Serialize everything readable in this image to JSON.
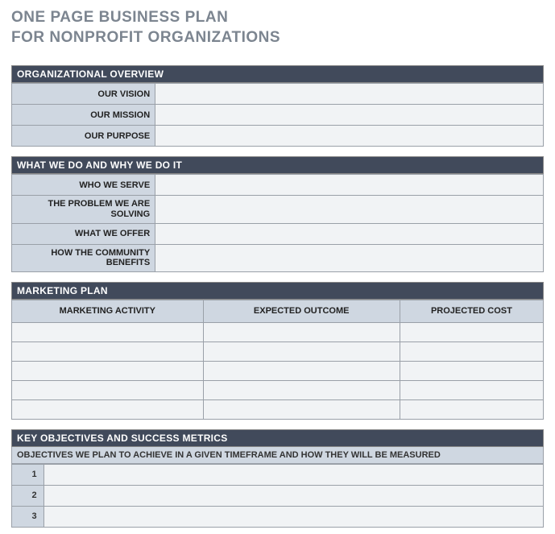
{
  "title_line1": "ONE PAGE BUSINESS PLAN",
  "title_line2": "FOR NONPROFIT ORGANIZATIONS",
  "sections": {
    "overview": {
      "header": "ORGANIZATIONAL OVERVIEW",
      "rows": [
        {
          "label": "OUR VISION",
          "value": ""
        },
        {
          "label": "OUR MISSION",
          "value": ""
        },
        {
          "label": "OUR PURPOSE",
          "value": ""
        }
      ]
    },
    "what_we_do": {
      "header": "WHAT WE DO AND WHY WE DO IT",
      "rows": [
        {
          "label": "WHO WE SERVE",
          "value": ""
        },
        {
          "label": "THE PROBLEM WE ARE SOLVING",
          "value": ""
        },
        {
          "label": "WHAT WE OFFER",
          "value": ""
        },
        {
          "label": "HOW THE COMMUNITY BENEFITS",
          "value": ""
        }
      ]
    },
    "marketing": {
      "header": "MARKETING PLAN",
      "columns": [
        "MARKETING ACTIVITY",
        "EXPECTED OUTCOME",
        "PROJECTED COST"
      ],
      "rows": [
        [
          "",
          "",
          ""
        ],
        [
          "",
          "",
          ""
        ],
        [
          "",
          "",
          ""
        ],
        [
          "",
          "",
          ""
        ],
        [
          "",
          "",
          ""
        ]
      ]
    },
    "objectives": {
      "header": "KEY OBJECTIVES AND SUCCESS METRICS",
      "subheader": "OBJECTIVES WE PLAN TO ACHIEVE IN A GIVEN TIMEFRAME AND HOW THEY WILL BE MEASURED",
      "rows": [
        {
          "num": "1",
          "value": ""
        },
        {
          "num": "2",
          "value": ""
        },
        {
          "num": "3",
          "value": ""
        }
      ]
    }
  }
}
